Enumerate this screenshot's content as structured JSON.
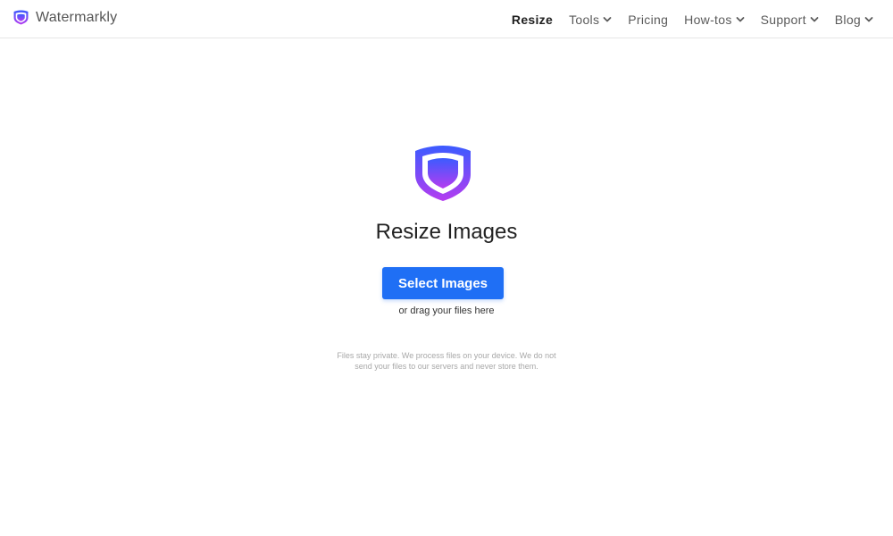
{
  "header": {
    "brand": {
      "name": "Watermarkly",
      "icon": "shield-logo-icon"
    },
    "nav": [
      {
        "label": "Resize",
        "active": true,
        "has_dropdown": false
      },
      {
        "label": "Tools",
        "active": false,
        "has_dropdown": true
      },
      {
        "label": "Pricing",
        "active": false,
        "has_dropdown": false
      },
      {
        "label": "How-tos",
        "active": false,
        "has_dropdown": true
      },
      {
        "label": "Support",
        "active": false,
        "has_dropdown": true
      },
      {
        "label": "Blog",
        "active": false,
        "has_dropdown": true
      }
    ]
  },
  "main": {
    "icon": "shield-logo-icon",
    "title": "Resize Images",
    "select_button": "Select Images",
    "drag_hint": "or drag your files here",
    "privacy_line1": "Files stay private. We process files on your device. We do not",
    "privacy_line2": "send your files to our servers and never store them."
  },
  "colors": {
    "accent": "#1f6ff5",
    "logo_gradient_top": "#3b5bff",
    "logo_gradient_bottom": "#b53cf0"
  }
}
